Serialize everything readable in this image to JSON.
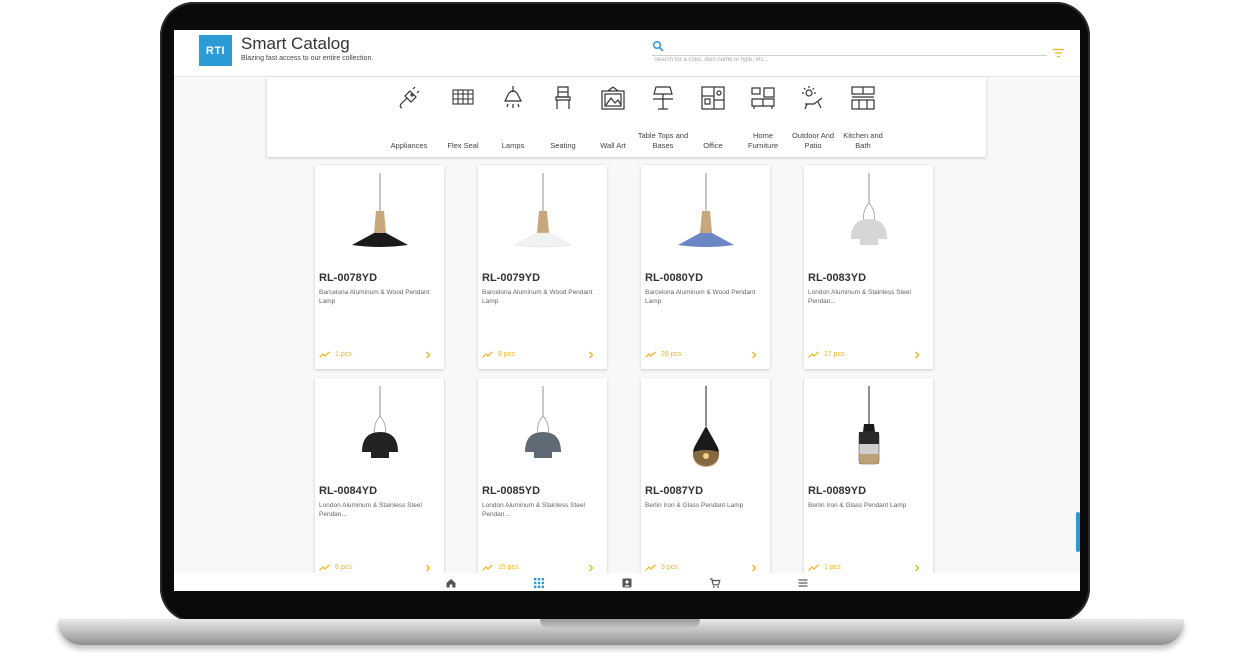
{
  "header": {
    "logo_text": "RTI",
    "title": "Smart Catalog",
    "subtitle": "Blazing fast access to our entire collection.",
    "search_placeholder": "Search for a color, item name or type, etc..."
  },
  "categories": [
    {
      "label": "Appliances",
      "icon": "appliance-plug-icon"
    },
    {
      "label": "Flex Seal",
      "icon": "flex-seal-icon"
    },
    {
      "label": "Lamps",
      "icon": "lamp-icon"
    },
    {
      "label": "Seating",
      "icon": "chair-icon"
    },
    {
      "label": "Wall Art",
      "icon": "picture-frame-icon"
    },
    {
      "label": "Table Tops and Bases",
      "icon": "table-lamp-icon"
    },
    {
      "label": "Office",
      "icon": "office-plan-icon"
    },
    {
      "label": "Home Furniture",
      "icon": "furniture-icon"
    },
    {
      "label": "Outdoor And Patio",
      "icon": "sun-lounger-icon"
    },
    {
      "label": "Kitchen and Bath",
      "icon": "kitchen-cabinet-icon"
    }
  ],
  "products": [
    {
      "sku": "RL-0078YD",
      "desc": "Barcelona Aluminum & Wood Pendant Lamp",
      "stock": "1 pcs",
      "shade": "#1a1a1a"
    },
    {
      "sku": "RL-0079YD",
      "desc": "Barcelona Aluminum & Wood Pendant Lamp",
      "stock": "9 pcs",
      "shade": "#f2f2f2"
    },
    {
      "sku": "RL-0080YD",
      "desc": "Barcelona Aluminum & Wood Pendant Lamp",
      "stock": "28 pcs",
      "shade": "#6a86c4"
    },
    {
      "sku": "RL-0083YD",
      "desc": "London Aluminum & Stainless Steel Pendan...",
      "stock": "17 pcs",
      "shade": "#d6d6d6"
    },
    {
      "sku": "RL-0084YD",
      "desc": "London Aluminum & Stainless Steel Pendan...",
      "stock": "6 pcs",
      "shade": "#222222"
    },
    {
      "sku": "RL-0085YD",
      "desc": "London Aluminum & Stainless Steel Pendan...",
      "stock": "15 pcs",
      "shade": "#5f6a75"
    },
    {
      "sku": "RL-0087YD",
      "desc": "Berlin Iron & Glass Pendant Lamp",
      "stock": "3 pcs",
      "shade": "#1a1a1a"
    },
    {
      "sku": "RL-0089YD",
      "desc": "Berlin Iron & Glass Pendant Lamp",
      "stock": "1 pcs",
      "shade": "#1a1a1a"
    }
  ],
  "bottom_nav": [
    {
      "icon": "home-icon"
    },
    {
      "icon": "grid-icon",
      "active": true
    },
    {
      "icon": "contact-card-icon"
    },
    {
      "icon": "cart-icon"
    },
    {
      "icon": "menu-icon"
    }
  ],
  "colors": {
    "accent": "#2b9bd6",
    "stock": "#f4b21b"
  }
}
